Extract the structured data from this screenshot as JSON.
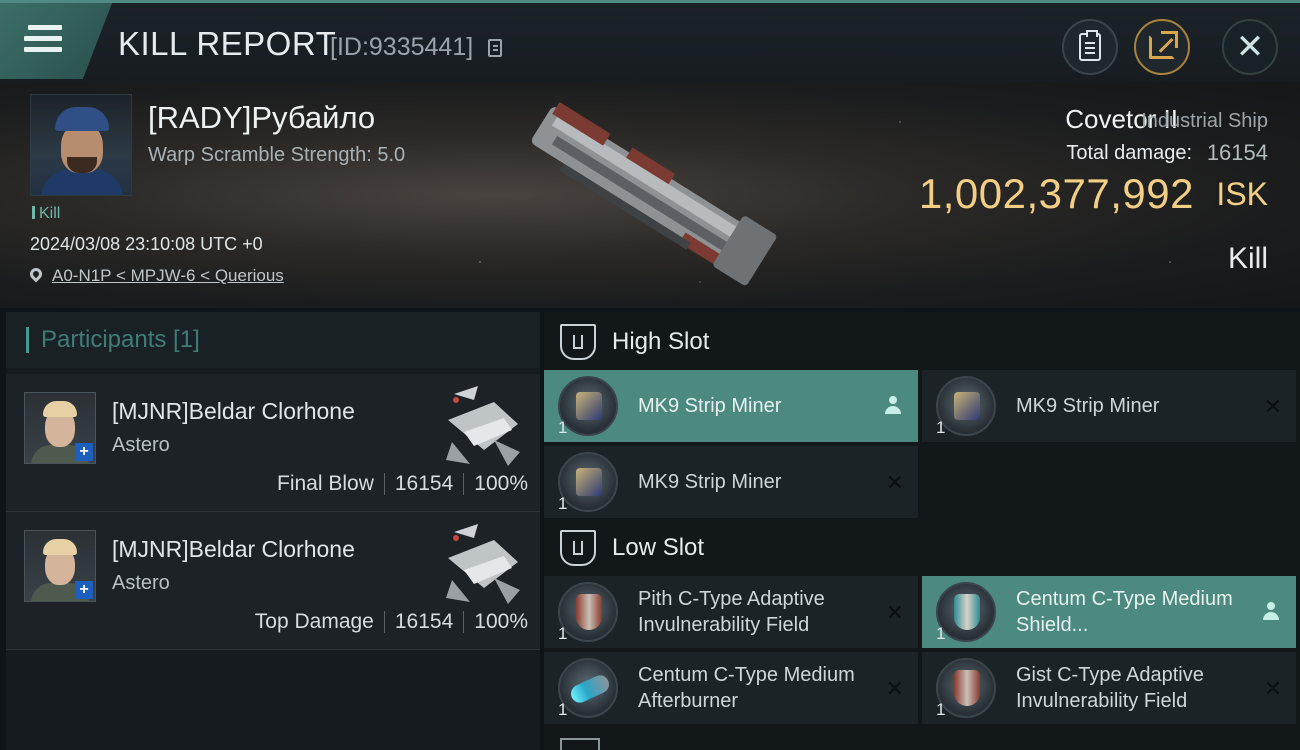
{
  "header": {
    "title": "KILL REPORT",
    "report_id": "[ID:9335441]",
    "menu_icon": "hamburger-menu-icon",
    "buttons": {
      "clipboard_icon": "clipboard-icon",
      "share_icon": "share-external-icon",
      "close_icon": "close-icon",
      "close_glyph": "✕"
    }
  },
  "victim": {
    "name": "[RADY]Рубайло",
    "warp_scramble": "Warp Scramble Strength: 5.0",
    "tag": "Kill",
    "datetime": "2024/03/08 23:10:08 UTC +0",
    "location": "A0-N1P < MPJW-6 < Querious",
    "ship_name": "Covetor II",
    "ship_class": "Industrial Ship",
    "total_damage_label": "Total damage:",
    "total_damage_value": "16154",
    "isk_value": "1,002,377,992",
    "isk_unit": "ISK",
    "result": "Kill"
  },
  "participants": {
    "header": "Participants [1]",
    "rows": [
      {
        "name": "[MJNR]Beldar Clorhone",
        "ship": "Astero",
        "role": "Final Blow",
        "damage": "16154",
        "percent": "100%"
      },
      {
        "name": "[MJNR]Beldar Clorhone",
        "ship": "Astero",
        "role": "Top Damage",
        "damage": "16154",
        "percent": "100%"
      }
    ]
  },
  "fitting": {
    "high_slot": {
      "title": "High Slot",
      "modules": [
        {
          "name": "MK9 Strip Miner",
          "qty": "1",
          "status": "person"
        },
        {
          "name": "MK9 Strip Miner",
          "qty": "1",
          "status": "destroyed"
        },
        {
          "name": "MK9 Strip Miner",
          "qty": "1",
          "status": "destroyed"
        }
      ]
    },
    "low_slot": {
      "title": "Low Slot",
      "modules": [
        {
          "name": "Pith C-Type Adaptive Invulnerability Field",
          "qty": "1",
          "status": "destroyed"
        },
        {
          "name": "Centum C-Type Medium Shield...",
          "qty": "1",
          "status": "person"
        },
        {
          "name": "Centum C-Type Medium Afterburner",
          "qty": "1",
          "status": "destroyed"
        },
        {
          "name": "Gist C-Type Adaptive Invulnerability Field",
          "qty": "1",
          "status": "destroyed"
        }
      ]
    },
    "destroyed_glyph": "✕"
  },
  "colors": {
    "accent_teal": "#4c8a80",
    "isk_gold": "#f2cf85",
    "background": "#0f1418"
  }
}
